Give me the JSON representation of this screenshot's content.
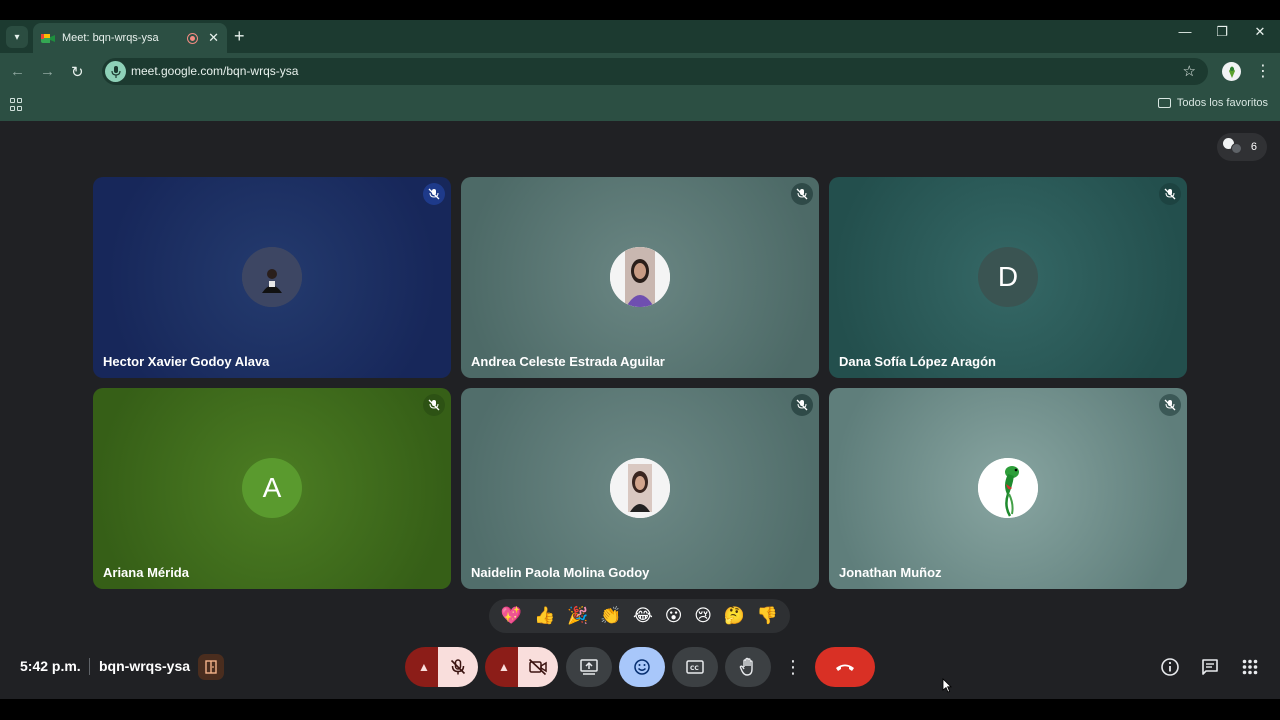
{
  "browser": {
    "tab_title": "Meet: bqn-wrqs-ysa",
    "new_tab_symbol": "+",
    "close_symbol": "✕",
    "url": "meet.google.com/bqn-wrqs-ysa",
    "bookmark_folder": "Todos los favoritos"
  },
  "meet": {
    "participant_count": "6",
    "tiles": [
      {
        "name": "Hector Xavier Godoy Alava",
        "avatar_type": "photo",
        "background": "#1b2d59"
      },
      {
        "name": "Andrea Celeste Estrada Aguilar",
        "avatar_type": "photo",
        "background": "#5a7773"
      },
      {
        "name": "Dana Sofía López Aragón",
        "avatar_letter": "D",
        "avatar_color": "#3a5452",
        "background": "#2a5a57"
      },
      {
        "name": "Ariana Mérida",
        "avatar_letter": "A",
        "avatar_color": "#5a9a2e",
        "background": "#3e6a1d"
      },
      {
        "name": "Naidelin Paola Molina Godoy",
        "avatar_type": "photo",
        "background": "#5e7b77"
      },
      {
        "name": "Jonathan Muñoz",
        "avatar_type": "photo",
        "background": "#6e8d8a"
      }
    ],
    "reactions": [
      "💖",
      "👍",
      "🎉",
      "👏",
      "😂",
      "😮",
      "😢",
      "🤔",
      "👎"
    ],
    "clock": "5:42 p.m.",
    "meeting_code": "bqn-wrqs-ysa",
    "controls": [
      "mic-options",
      "mic-muted",
      "camera-options",
      "camera-off",
      "present",
      "reactions",
      "captions",
      "raise-hand",
      "more-options",
      "leave-call"
    ],
    "right_controls": [
      "info",
      "chat",
      "activities"
    ],
    "colors": {
      "chrome_dark": "#1c3a30",
      "chrome_toolbar": "#2c4f43",
      "meet_bg": "#202124",
      "end_call": "#d93025",
      "muted_red": "#8c1d18",
      "muted_pink": "#f9dedc",
      "reactions_active": "#a8c7fa"
    }
  }
}
